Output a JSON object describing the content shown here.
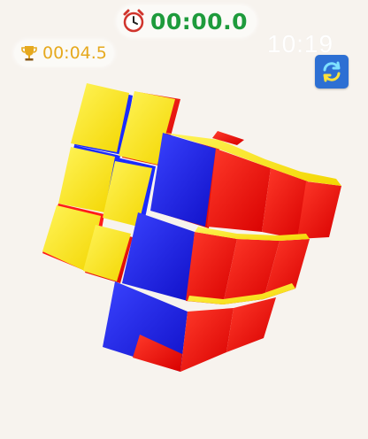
{
  "timer": {
    "value": "00:00.0",
    "icon": "alarm-clock-icon"
  },
  "best_time": {
    "value": "00:04.5",
    "icon": "trophy-icon"
  },
  "clock": {
    "time": "10:19"
  },
  "reset_button": {
    "icon": "rotate-cube-icon"
  },
  "colors": {
    "background": "#f7f3ee",
    "timer_text": "#1e9b3c",
    "best_text": "#e6a91e",
    "button": "#2d6fd3",
    "cube_yellow": "#ffee00",
    "cube_red": "#ff1a1a",
    "cube_blue": "#1a2bff"
  }
}
